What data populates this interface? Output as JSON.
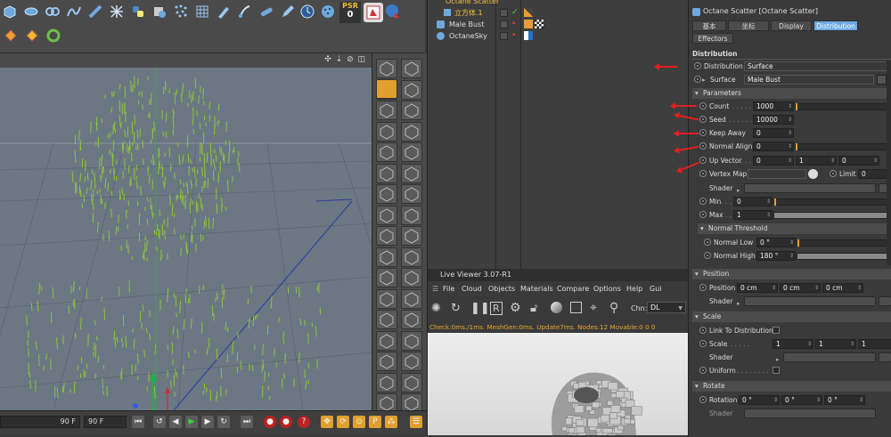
{
  "toolbar": {
    "psr_label": "PSR",
    "psr_value": "0",
    "icons": [
      "cube-icon",
      "bend-icon",
      "array-icon",
      "spline-icon",
      "pipe-icon",
      "connect-icon",
      "python-icon",
      "tags-icon",
      "particles-icon",
      "grid-icon",
      "paint-icon",
      "brush-icon",
      "pills-icon",
      "pen-icon",
      "clock-icon",
      "mograph-icon",
      "render-view-icon",
      "picture-viewer-icon",
      "octane-icon"
    ],
    "second_row": [
      "light-bulb-icon",
      "sun-icon",
      "refresh-icon"
    ]
  },
  "timeline": {
    "frame_field": "90 F",
    "frame_field_2": "90 F"
  },
  "object_manager": {
    "rows": [
      {
        "name": "Octane Scatter",
        "selected": true
      },
      {
        "name": "立方体.1",
        "selected": true
      },
      {
        "name": "Male Bust",
        "selected": false
      },
      {
        "name": "OctaneSky",
        "selected": false
      }
    ]
  },
  "live_viewer": {
    "title": "Live Viewer 3.07-R1",
    "menu": [
      "File",
      "Cloud",
      "Objects",
      "Materials",
      "Compare",
      "Options",
      "Help",
      "Gui"
    ],
    "chn_label": "Chn:",
    "chn_value": "DL",
    "status": "Check:0ms./1ms. MeshGen:0ms. Update7ms. Nodes:12 Movable:0  0 0"
  },
  "attributes": {
    "title": "Octane Scatter [Octane Scatter]",
    "tabs": [
      "基本",
      "坐标",
      "Display",
      "Distribution",
      "Effectors"
    ],
    "active_tab": "Distribution",
    "heading": "Distribution",
    "distribution_label": "Distribution",
    "distribution_value": "Surface",
    "surface_label": "Surface",
    "surface_value": "Male Bust",
    "parameters_section": "Parameters",
    "count_label": "Count",
    "count_value": "1000",
    "seed_label": "Seed",
    "seed_value": "10000",
    "keep_away_label": "Keep Away",
    "keep_away_value": "0",
    "normal_align_label": "Normal Align",
    "normal_align_value": "0",
    "up_vector_label": "Up Vector",
    "up_vector_values": [
      "0",
      "1",
      "0"
    ],
    "vertex_map_label": "Vertex Map",
    "limit_label": "Limit",
    "limit_value": "0",
    "shader_label": "Shader",
    "min_label": "Min",
    "min_value": "0",
    "max_label": "Max",
    "max_value": "1",
    "normal_threshold_section": "Normal Threshold",
    "normal_low_label": "Normal Low",
    "normal_low_value": "0 °",
    "normal_high_label": "Normal High",
    "normal_high_value": "180 °",
    "position_section": "Position",
    "position_label": "Position",
    "position_values": [
      "0 cm",
      "0 cm",
      "0 cm"
    ],
    "position_shader_label": "Shader",
    "scale_section": "Scale",
    "link_to_distribution_label": "Link To Distribution",
    "scale_label": "Scale",
    "scale_values": [
      "1",
      "1",
      "1"
    ],
    "scale_shader_label": "Shader",
    "uniform_label": "Uniform",
    "rotate_section": "Rotate",
    "rotation_label": "Rotation",
    "rotation_values": [
      "0 °",
      "0 °",
      "0 °"
    ],
    "rotate_shader_label": "Shader"
  },
  "colors": {
    "accent": "#6aa9e2",
    "annotation_arrow": "#e02020",
    "slider_knob": "#f0a020",
    "viewport_bg": "#6c7784",
    "points": "#8fc43a"
  }
}
